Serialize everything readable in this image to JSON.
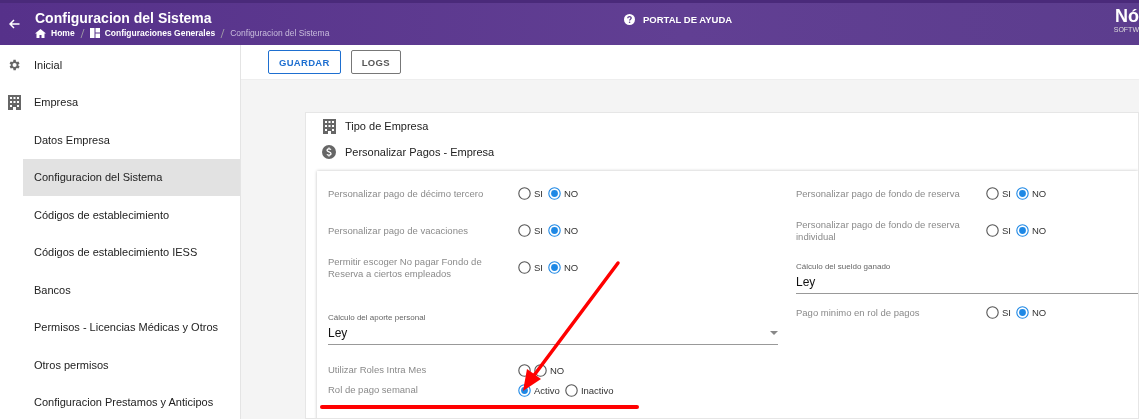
{
  "header": {
    "title": "Configuracion del Sistema",
    "breadcrumbs": [
      {
        "label": "Home",
        "kind": "home"
      },
      {
        "label": "Configuraciones Generales",
        "kind": "grid"
      },
      {
        "label": "Configuracion del Sistema",
        "kind": "current"
      }
    ],
    "help": "PORTAL DE AYUDA",
    "logo": {
      "name": "Nó",
      "tagline": "SOFTW"
    }
  },
  "sidebar": {
    "items": [
      {
        "label": "Inicial",
        "kind": "gear",
        "selected": false
      },
      {
        "label": "Empresa",
        "kind": "building",
        "selected": false
      },
      {
        "label": "Datos Empresa",
        "kind": "sub",
        "selected": false
      },
      {
        "label": "Configuracion del Sistema",
        "kind": "sub",
        "selected": true
      },
      {
        "label": "Códigos de establecimiento",
        "kind": "sub",
        "selected": false
      },
      {
        "label": "Códigos de establecimiento IESS",
        "kind": "sub",
        "selected": false
      },
      {
        "label": "Bancos",
        "kind": "sub",
        "selected": false
      },
      {
        "label": "Permisos - Licencias Médicas y Otros",
        "kind": "sub",
        "selected": false
      },
      {
        "label": "Otros permisos",
        "kind": "sub",
        "selected": false
      },
      {
        "label": "Configuracion Prestamos y Anticipos",
        "kind": "sub",
        "selected": false
      }
    ]
  },
  "toolbar": {
    "buttons": [
      {
        "label": "GUARDAR",
        "kind": "primary"
      },
      {
        "label": "LOGS",
        "kind": "plain"
      }
    ]
  },
  "sections": [
    {
      "title": "Tipo de Empresa",
      "kind": "building"
    },
    {
      "title": "Personalizar Pagos - Empresa",
      "kind": "money"
    }
  ],
  "form": {
    "left": [
      {
        "kind": "radio",
        "label": "Personalizar pago de décimo tercero",
        "options": [
          {
            "label": "SI",
            "selected": false
          },
          {
            "label": "NO",
            "selected": true
          }
        ]
      },
      {
        "kind": "radio",
        "label": "Personalizar pago de vacaciones",
        "options": [
          {
            "label": "SI",
            "selected": false
          },
          {
            "label": "NO",
            "selected": true
          }
        ]
      },
      {
        "kind": "radio",
        "label": "Permitir escoger No pagar Fondo de Reserva a ciertos empleados",
        "options": [
          {
            "label": "SI",
            "selected": false
          },
          {
            "label": "NO",
            "selected": true
          }
        ]
      },
      {
        "kind": "select",
        "label": "Cálculo del aporte personal",
        "value": "Ley"
      },
      {
        "kind": "radio-compact",
        "label": "Utilizar Roles Intra Mes",
        "options": [
          {
            "selected": false
          },
          {
            "label": "NO",
            "selected": false
          }
        ]
      },
      {
        "kind": "radio-compact",
        "label": "Rol de pago semanal",
        "options": [
          {
            "label": "Activo",
            "selected": true
          },
          {
            "label": "Inactivo",
            "selected": false
          }
        ]
      }
    ],
    "right": [
      {
        "kind": "radio",
        "label": "Personalizar pago de fondo de reserva",
        "options": [
          {
            "label": "SI",
            "selected": false
          },
          {
            "label": "NO",
            "selected": true
          }
        ]
      },
      {
        "kind": "radio",
        "label": "Personalizar pago de fondo de reserva individual",
        "options": [
          {
            "label": "SI",
            "selected": false
          },
          {
            "label": "NO",
            "selected": true
          }
        ]
      },
      {
        "kind": "text",
        "label": "Cálculo del sueldo ganado",
        "value": "Ley"
      },
      {
        "kind": "radio",
        "label": "Pago minimo en rol de pagos",
        "options": [
          {
            "label": "SI",
            "selected": false
          },
          {
            "label": "NO",
            "selected": true
          }
        ]
      }
    ]
  },
  "annotations": {
    "arrow": true,
    "underline": true
  }
}
